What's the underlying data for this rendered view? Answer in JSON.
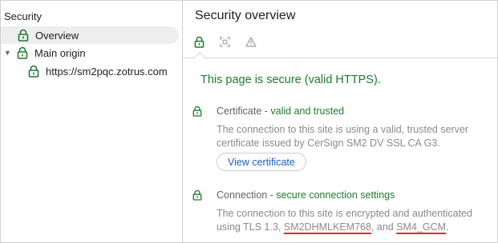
{
  "sidebar": {
    "title": "Security",
    "overview_label": "Overview",
    "main_origin_label": "Main origin",
    "origin_url": "https://sm2pqc.zotrus.com"
  },
  "main": {
    "title": "Security overview",
    "headline": "This page is secure (valid HTTPS).",
    "certificate": {
      "head_label": "Certificate",
      "head_sep": " - ",
      "head_status": "valid and trusted",
      "body": "The connection to this site is using a valid, trusted server certificate issued by CerSign SM2 DV SSL CA G3.",
      "button_label": "View certificate"
    },
    "connection": {
      "head_label": "Connection",
      "head_sep": " - ",
      "head_status": "secure connection settings",
      "body_prefix": "The connection to this site is encrypted and authenticated using TLS 1.3, ",
      "key_exchange": "SM2DHMLKEM768",
      "body_mid": ", and ",
      "cipher": "SM4_GCM",
      "body_suffix": "."
    }
  },
  "colors": {
    "secure_green": "#1e7c30",
    "link_blue": "#1a5fbf",
    "annotation_red": "#e0282e"
  },
  "icons": {
    "tab_security": "lock-icon",
    "tab_capture": "screen-capture-icon",
    "tab_warning": "warning-icon"
  }
}
